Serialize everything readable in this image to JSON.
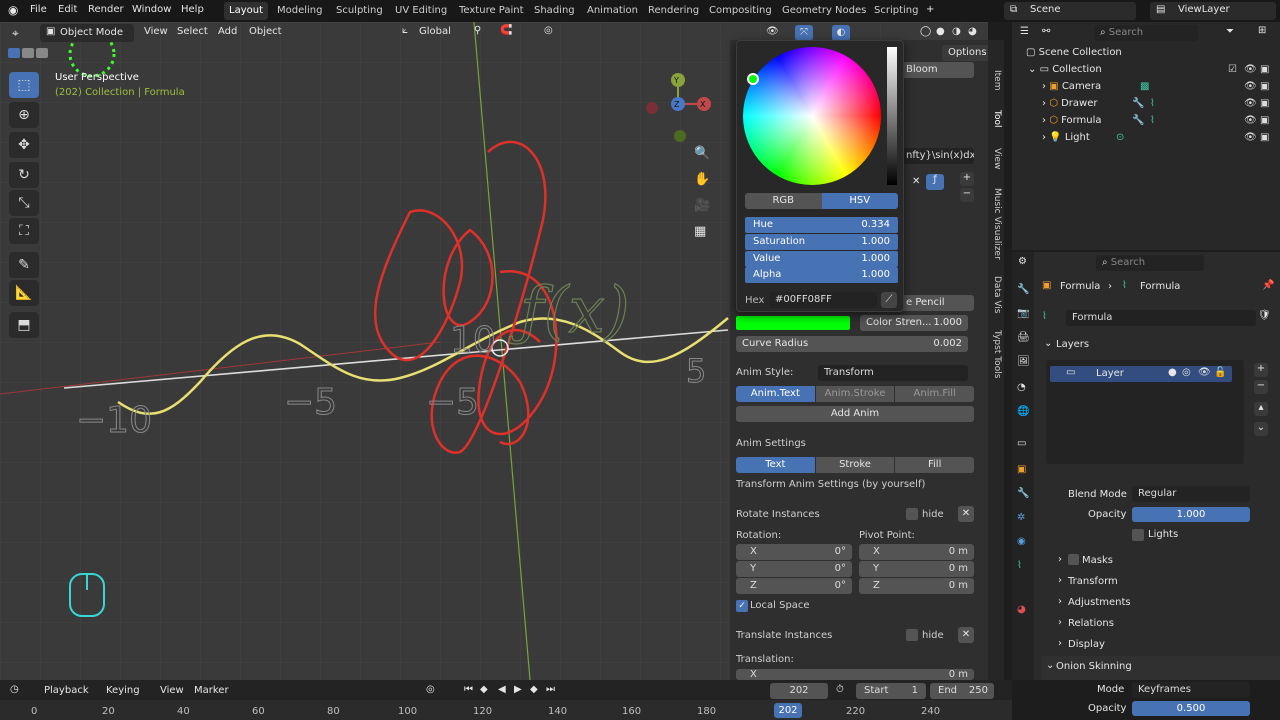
{
  "topbar": {
    "menus": [
      "File",
      "Edit",
      "Render",
      "Window",
      "Help"
    ],
    "workspaces": [
      "Layout",
      "Modeling",
      "Sculpting",
      "UV Editing",
      "Texture Paint",
      "Shading",
      "Animation",
      "Rendering",
      "Compositing",
      "Geometry Nodes",
      "Scripting"
    ],
    "add": "+",
    "scene": "Scene",
    "view_layer": "ViewLayer"
  },
  "viewport": {
    "mode": "Object Mode",
    "menus": [
      "View",
      "Select",
      "Add",
      "Object"
    ],
    "transform": "Global",
    "options": "Options",
    "perspective": "User Perspective",
    "context": "(202) Collection | Formula",
    "axis_x": "X",
    "axis_y": "Y",
    "axis_z": "Z",
    "tick_labels": [
      "−10",
      "−5",
      "−5",
      "10",
      "5"
    ]
  },
  "npanel": {
    "tabs": [
      "Item",
      "Tool",
      "View",
      "Music Visualizer",
      "Data Vis",
      "Typst Tools"
    ],
    "bloom": "Bloom",
    "formula": "nfty}\\sin(x)dx",
    "pencil": "e Pencil",
    "color_strength_label": "Color Stren...",
    "color_strength": "1.000",
    "curve_radius_label": "Curve Radius",
    "curve_radius": "0.002",
    "anim_style_label": "Anim Style:",
    "anim_style": "Transform",
    "anim_tabs": [
      "Anim.Text",
      "Anim.Stroke",
      "Anim.Fill"
    ],
    "add_anim": "Add Anim",
    "anim_settings": "Anim Settings",
    "settings_tabs": [
      "Text",
      "Stroke",
      "Fill"
    ],
    "transform_note": "Transform Anim Settings (by yourself)",
    "rotate_instances": "Rotate Instances",
    "hide": "hide",
    "rotation_label": "Rotation:",
    "pivot_label": "Pivot Point:",
    "rotation": [
      {
        "axis": "X",
        "value": "0°"
      },
      {
        "axis": "Y",
        "value": "0°"
      },
      {
        "axis": "Z",
        "value": "0°"
      }
    ],
    "pivot": [
      {
        "axis": "X",
        "value": "0 m"
      },
      {
        "axis": "Y",
        "value": "0 m"
      },
      {
        "axis": "Z",
        "value": "0 m"
      }
    ],
    "local_space": "Local Space",
    "translate_instances": "Translate Instances",
    "translation_label": "Translation:",
    "translation_x": "X",
    "translation_x_value": "0 m"
  },
  "picker": {
    "modes": [
      "RGB",
      "HSV"
    ],
    "hue_label": "Hue",
    "hue": "0.334",
    "sat_label": "Saturation",
    "sat": "1.000",
    "val_label": "Value",
    "val": "1.000",
    "alpha_label": "Alpha",
    "alpha": "1.000",
    "hex_label": "Hex",
    "hex": "#00FF08FF",
    "swatch_color": "#00ff08"
  },
  "outliner": {
    "search": "Search",
    "root": "Scene Collection",
    "collection": "Collection",
    "items": [
      "Camera",
      "Drawer",
      "Formula",
      "Light"
    ]
  },
  "properties": {
    "search": "Search",
    "breadcrumb_obj": "Formula",
    "breadcrumb_data": "Formula",
    "data_name": "Formula",
    "layers_label": "Layers",
    "layer_name": "Layer",
    "blend_label": "Blend Mode",
    "blend": "Regular",
    "opacity_label": "Opacity",
    "opacity": "1.000",
    "lights": "Lights",
    "sections": [
      "Masks",
      "Transform",
      "Adjustments",
      "Relations",
      "Display"
    ],
    "onion": "Onion Skinning",
    "onion_mode_label": "Mode",
    "onion_mode": "Keyframes",
    "onion_opacity_label": "Opacity",
    "onion_opacity": "0.500"
  },
  "timeline": {
    "menus": [
      "Playback",
      "Keying",
      "View",
      "Marker"
    ],
    "frame": "202",
    "start_label": "Start",
    "start": "1",
    "end_label": "End",
    "end": "250",
    "ticks": [
      "0",
      "20",
      "40",
      "60",
      "80",
      "100",
      "120",
      "140",
      "160",
      "180",
      "200",
      "220",
      "240"
    ],
    "current": "202"
  },
  "colors": {
    "accent": "#4772b3",
    "curve_red": "#e0302a",
    "curve_yellow": "#e8e070",
    "green": "#00ff08"
  }
}
